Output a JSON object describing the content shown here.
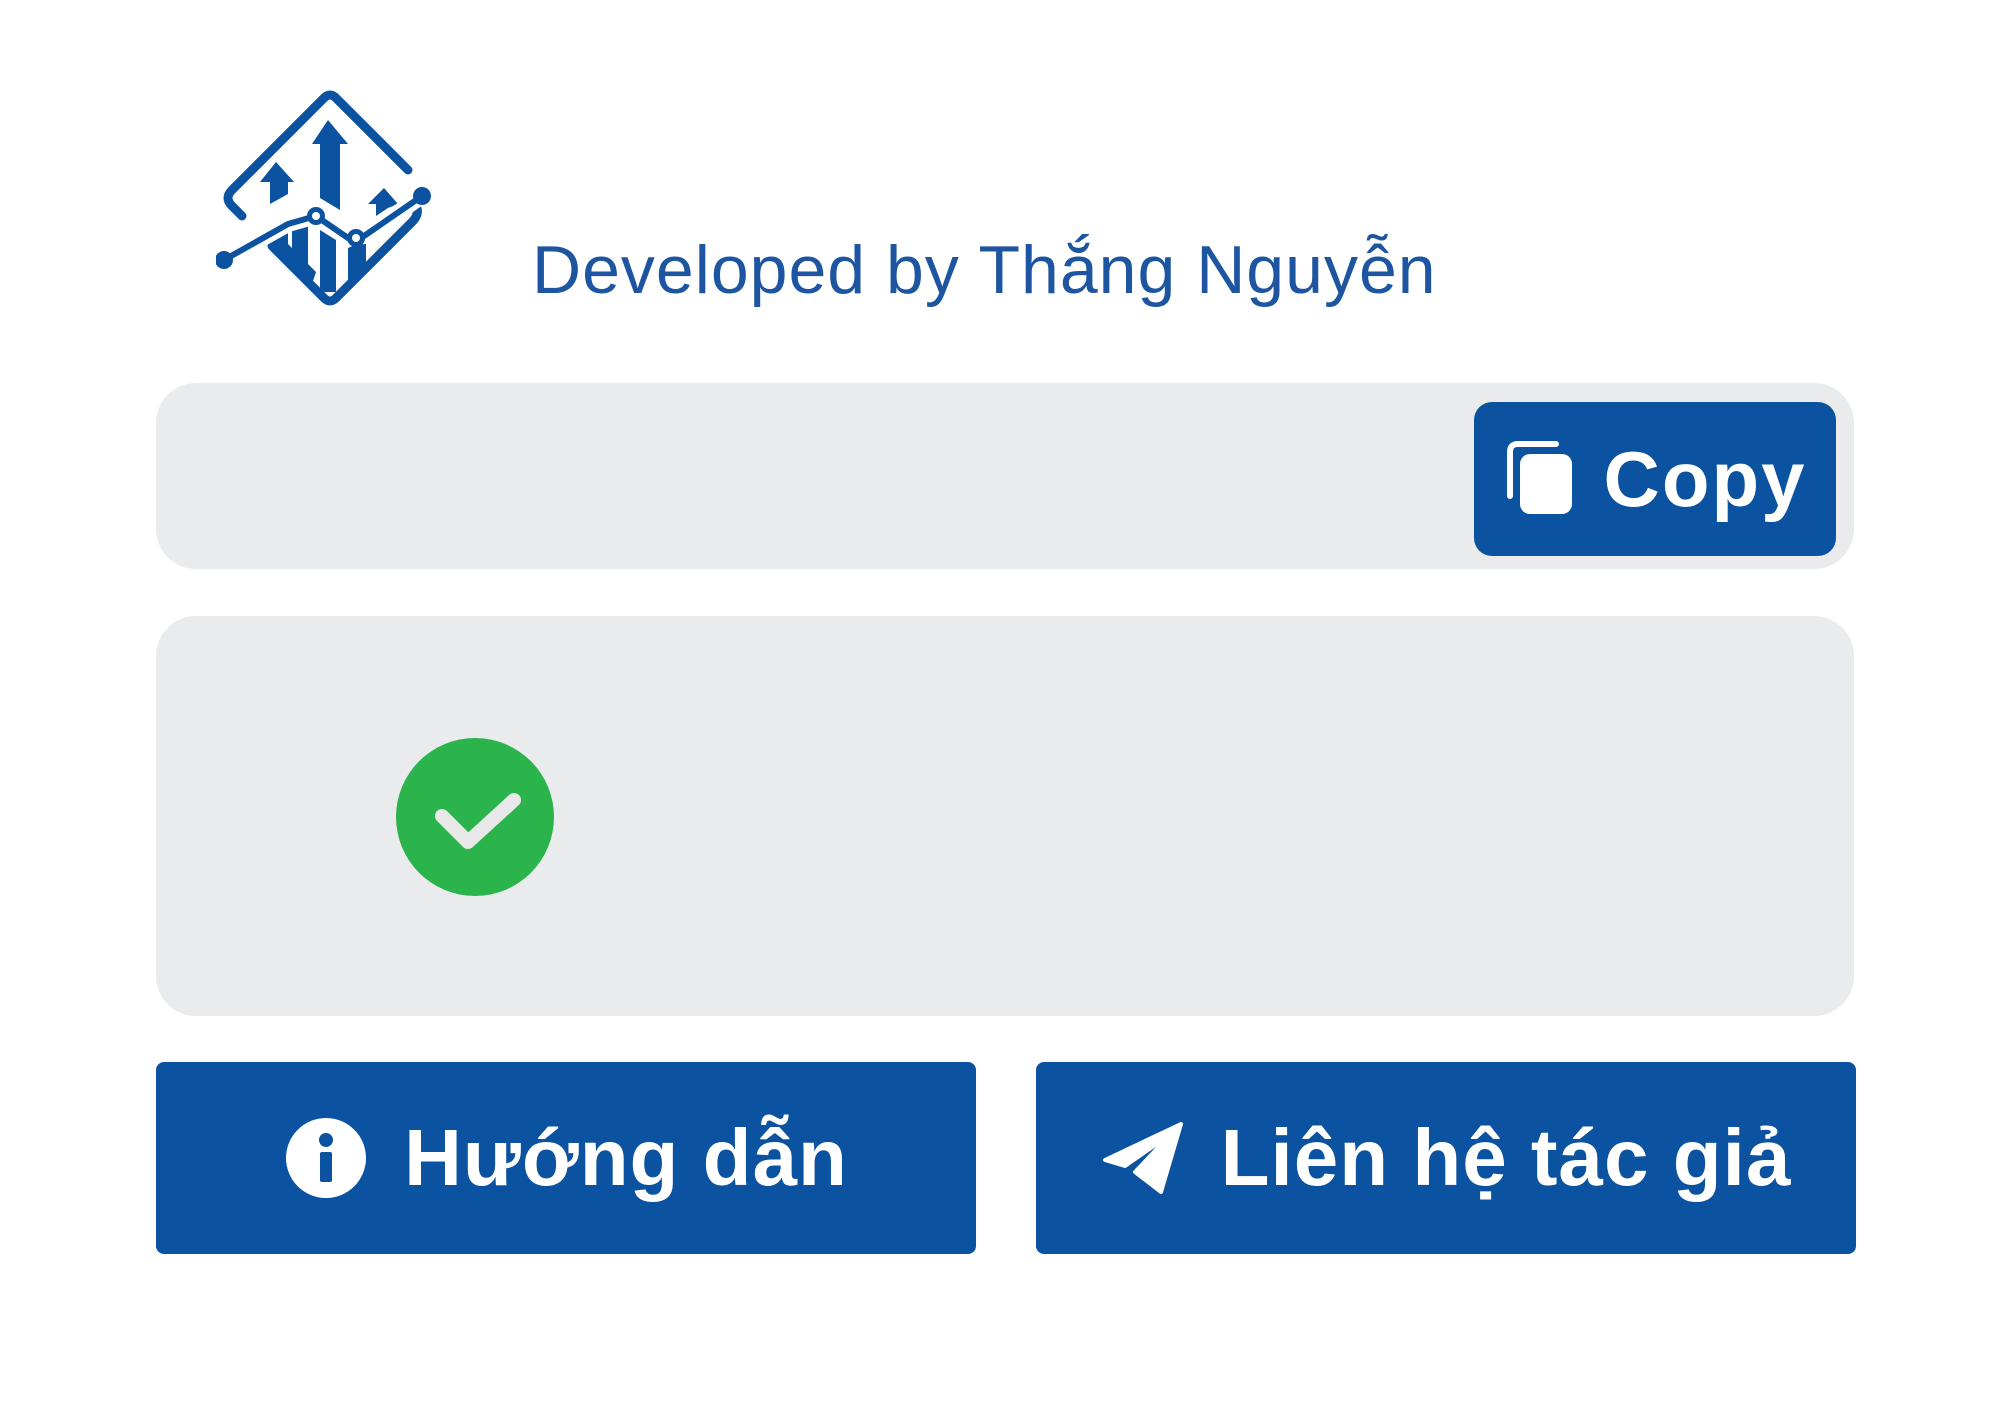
{
  "header": {
    "logo_icon": "stock-chart-diamond-logo",
    "developer_credit": "Developed by Thắng Nguyễn"
  },
  "code_field": {
    "value": "",
    "copy_button": {
      "label": "Copy",
      "icon": "copy-icon"
    }
  },
  "status_panel": {
    "icon": "check-circle-icon",
    "status": "success"
  },
  "actions": {
    "guide": {
      "label": "Hướng dẫn",
      "icon": "info-icon"
    },
    "contact": {
      "label": "Liên hệ tác giả",
      "icon": "telegram-send-icon"
    }
  },
  "colors": {
    "primary_blue": "#0b52a0",
    "text_blue": "#1d55a0",
    "panel_gray": "#eaebec",
    "success_green": "#2bb34c",
    "white": "#ffffff"
  }
}
